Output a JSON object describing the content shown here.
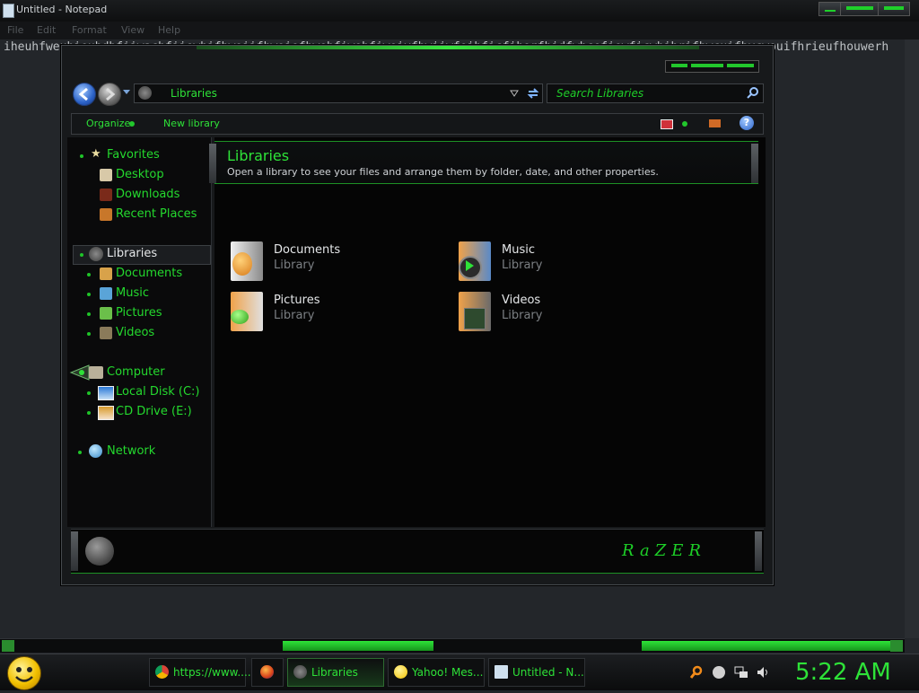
{
  "notepad": {
    "title": "Untitled - Notepad",
    "menu": [
      "File",
      "Edit",
      "Format",
      "View",
      "Help"
    ],
    "text": "iheuhfweuhieubdbfiiwachfiiewhifbwoiifhwoiefbwehfiwohfiwoivfbwiiwfoihficfihorfhidfwhcefiewficwhihrifbwcuifbvcwouifhrieufhouwerh"
  },
  "explorer": {
    "address": "Libraries",
    "search_placeholder": "Search Libraries",
    "toolbar": {
      "organize": "Organize",
      "new_library": "New library"
    },
    "nav": {
      "favorites": "Favorites",
      "desktop": "Desktop",
      "downloads": "Downloads",
      "recent": "Recent Places",
      "libraries": "Libraries",
      "documents": "Documents",
      "music": "Music",
      "pictures": "Pictures",
      "videos": "Videos",
      "computer": "Computer",
      "local_disk": "Local Disk (C:)",
      "cd_drive": "CD Drive (E:)",
      "network": "Network"
    },
    "banner": {
      "title": "Libraries",
      "subtitle": "Open a library to see your files and arrange them by folder, date, and other properties."
    },
    "libraries": [
      {
        "name": "Documents",
        "type": "Library"
      },
      {
        "name": "Music",
        "type": "Library"
      },
      {
        "name": "Pictures",
        "type": "Library"
      },
      {
        "name": "Videos",
        "type": "Library"
      }
    ],
    "brand": "RaZER"
  },
  "taskbar": {
    "tasks": [
      {
        "label": "https://www...."
      },
      {
        "label": ""
      },
      {
        "label": "Libraries"
      },
      {
        "label": "Yahoo! Mes..."
      },
      {
        "label": "Untitled - N..."
      }
    ],
    "clock": "5:22 AM"
  },
  "colors": {
    "accent": "#2ee238",
    "background": "#23262a"
  }
}
